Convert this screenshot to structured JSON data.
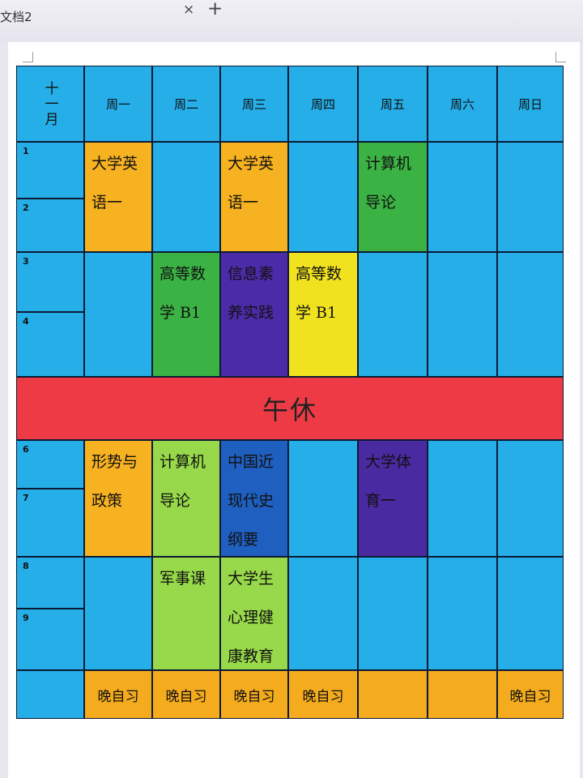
{
  "window": {
    "doc_title": "文档2",
    "close_symbol": "×",
    "new_tab_symbol": "+"
  },
  "timetable": {
    "month": "十一月",
    "days": [
      "周一",
      "周二",
      "周三",
      "周四",
      "周五",
      "周六",
      "周日"
    ],
    "periods": [
      "1",
      "2",
      "3",
      "4",
      "6",
      "7",
      "8",
      "9"
    ],
    "lunch": "午休",
    "evening": [
      "晚自习",
      "晚自习",
      "晚自习",
      "晚自习",
      "",
      "",
      "晚自习"
    ],
    "courses": {
      "mon_1_2": "大学英语一",
      "wed_1_2": "大学英语一",
      "fri_1_2": "计算机导论",
      "tue_3_4": "高等数学 B1",
      "wed_3_4": "信息素养实践",
      "thu_3_4": "高等数学 B1",
      "mon_6_7": "形势与政策",
      "tue_6_7": "计算机导论",
      "wed_6_7": "中国近现代史纲要",
      "fri_6_7": "大学体育一",
      "tue_8_9": "军事课",
      "wed_8_9": "大学生心理健康教育"
    },
    "colors": {
      "base": "#25aee8",
      "orange": "#f7b221",
      "green": "#3bb244",
      "purple": "#4b2ba8",
      "yellow": "#f0e21e",
      "lime": "#97d94a",
      "navy": "#1f5fbf",
      "lunch_red": "#ee3a45",
      "evening_orange": "#f4ab1d"
    }
  }
}
